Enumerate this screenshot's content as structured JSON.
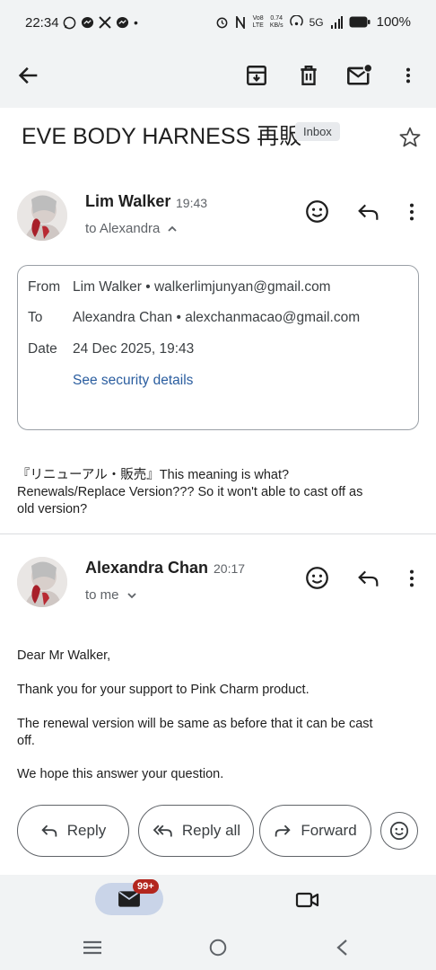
{
  "status_bar": {
    "time": "22:34",
    "network_speed_value": "0.74",
    "network_speed_unit": "KB/s",
    "volte_top": "Vo8",
    "volte_bottom": "LTE",
    "signal_label": "5G",
    "battery_percent": "100%",
    "dot": "•"
  },
  "app_bar": {
    "icons": [
      "back-arrow-icon",
      "archive-icon",
      "delete-icon",
      "mark-unread-icon",
      "more-vert-icon"
    ]
  },
  "email": {
    "subject": "EVE BODY HARNESS 再販",
    "label_chip": "Inbox"
  },
  "message1": {
    "sender": "Lim Walker",
    "time": "19:43",
    "to_line": "to Alexandra",
    "details": {
      "from_label": "From",
      "from_value": "Lim Walker • walkerlimjunyan@gmail.com",
      "to_label": "To",
      "to_value": "Alexandra Chan • alexchanmacao@gmail.com",
      "date_label": "Date",
      "date_value": "24 Dec 2025, 19:43",
      "security_link": "See security details"
    },
    "body_line1": "『リニューアル・販売』This meaning is what?",
    "body_line2": "Renewals/Replace Version??? So it won't able to cast off as",
    "body_line3": "old version?"
  },
  "message2": {
    "sender": "Alexandra Chan",
    "time": "20:17",
    "to_line": "to me",
    "greeting": "Dear Mr Walker,",
    "para1": "Thank you for your support to Pink Charm product.",
    "para2_line1": "The renewal version will be same as before that it can be cast",
    "para2_line2": "off.",
    "para3": "We hope this answer your question."
  },
  "actions": {
    "reply": "Reply",
    "reply_all": "Reply all",
    "forward": "Forward"
  },
  "bottom_nav": {
    "mail_badge": "99+"
  }
}
